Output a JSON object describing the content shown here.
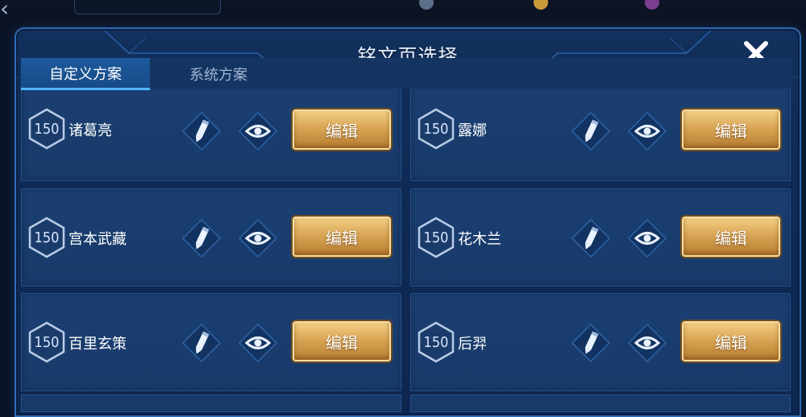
{
  "dialog": {
    "title": "铭文页选择",
    "tabs": [
      {
        "label": "自定义方案",
        "active": true
      },
      {
        "label": "系统方案",
        "active": false
      }
    ]
  },
  "cards": [
    {
      "level": "150",
      "hero": "诸葛亮",
      "edit_label": "编辑"
    },
    {
      "level": "150",
      "hero": "露娜",
      "edit_label": "编辑"
    },
    {
      "level": "150",
      "hero": "宫本武藏",
      "edit_label": "编辑"
    },
    {
      "level": "150",
      "hero": "花木兰",
      "edit_label": "编辑"
    },
    {
      "level": "150",
      "hero": "百里玄策",
      "edit_label": "编辑"
    },
    {
      "level": "150",
      "hero": "后羿",
      "edit_label": "编辑"
    }
  ],
  "icons": {
    "close": "close-icon",
    "rename": "pencil-icon",
    "preview": "eye-icon",
    "level": "hexagon-badge-icon"
  },
  "colors": {
    "accent_blue": "#4fb6ff",
    "edit_gold": "#d9a655",
    "panel_bg": "#12305d"
  }
}
